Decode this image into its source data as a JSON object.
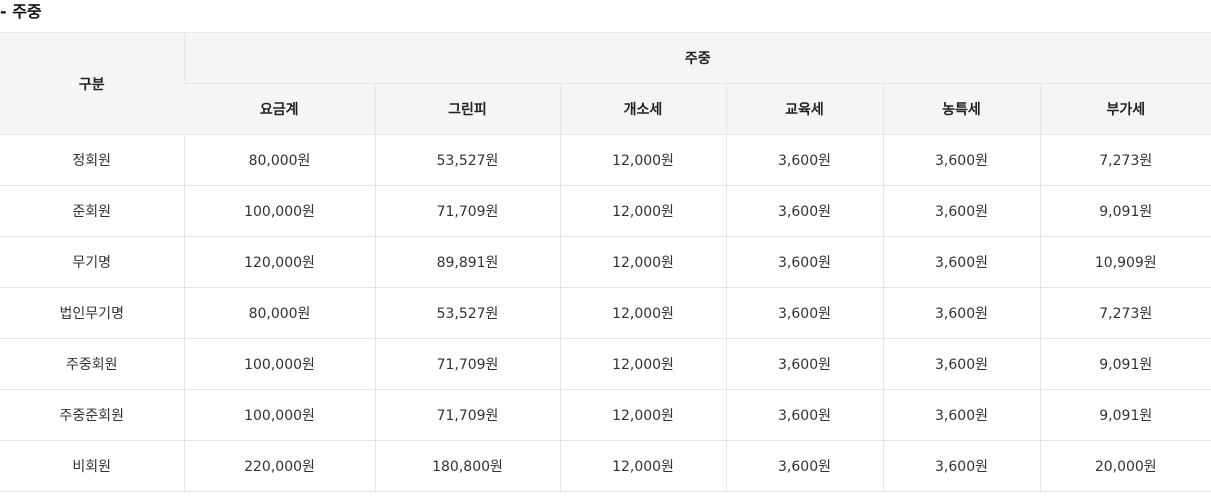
{
  "section": {
    "title": "- 주중"
  },
  "table": {
    "rowspan_header": "구분",
    "group_header": "주중",
    "columns": [
      "요금계",
      "그린피",
      "개소세",
      "교육세",
      "농특세",
      "부가세"
    ],
    "rows": [
      {
        "label": "정회원",
        "values": [
          "80,000원",
          "53,527원",
          "12,000원",
          "3,600원",
          "3,600원",
          "7,273원"
        ]
      },
      {
        "label": "준회원",
        "values": [
          "100,000원",
          "71,709원",
          "12,000원",
          "3,600원",
          "3,600원",
          "9,091원"
        ]
      },
      {
        "label": "무기명",
        "values": [
          "120,000원",
          "89,891원",
          "12,000원",
          "3,600원",
          "3,600원",
          "10,909원"
        ]
      },
      {
        "label": "법인무기명",
        "values": [
          "80,000원",
          "53,527원",
          "12,000원",
          "3,600원",
          "3,600원",
          "7,273원"
        ]
      },
      {
        "label": "주중회원",
        "values": [
          "100,000원",
          "71,709원",
          "12,000원",
          "3,600원",
          "3,600원",
          "9,091원"
        ]
      },
      {
        "label": "주중준회원",
        "values": [
          "100,000원",
          "71,709원",
          "12,000원",
          "3,600원",
          "3,600원",
          "9,091원"
        ]
      },
      {
        "label": "비회원",
        "values": [
          "220,000원",
          "180,800원",
          "12,000원",
          "3,600원",
          "3,600원",
          "20,000원"
        ]
      }
    ]
  }
}
